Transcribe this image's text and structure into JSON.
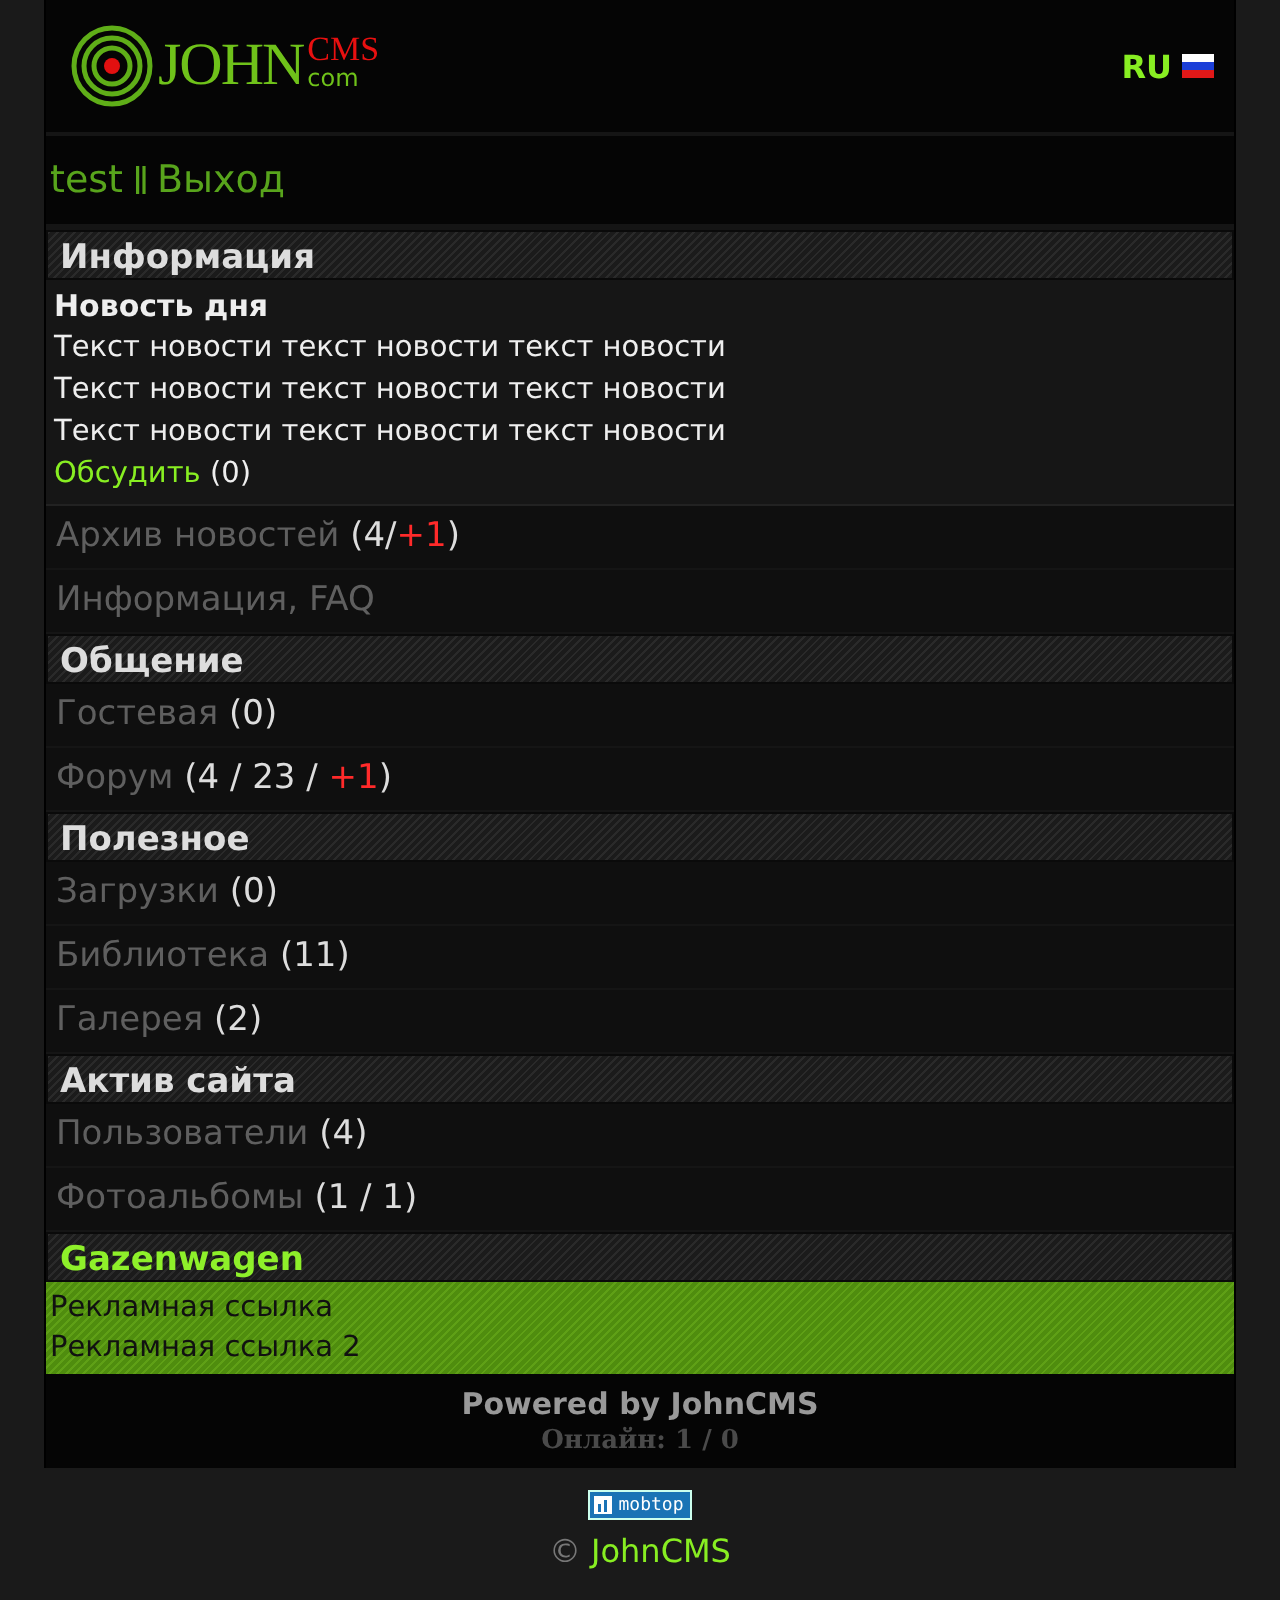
{
  "header": {
    "logo": {
      "name": "JOHN",
      "mark": "CMS",
      "domain": "com"
    },
    "language": "RU"
  },
  "user_bar": {
    "user": "test",
    "logout": "Выход"
  },
  "sections": [
    {
      "title": "Информация",
      "kind": "normal",
      "items": [
        {
          "kind": "news",
          "title": "Новость дня",
          "lines": [
            "Текст новости текст новости текст новости",
            "Текст новости текст новости текст новости",
            "Текст новости текст новости текст новости"
          ],
          "link": "Обсудить",
          "count": "(0)"
        },
        {
          "kind": "link",
          "label": "Архив новостей",
          "counter": [
            {
              "text": "(4/",
              "new": false
            },
            {
              "text": "+1",
              "new": true
            },
            {
              "text": ")",
              "new": false
            }
          ]
        },
        {
          "kind": "link",
          "label": "Информация, FAQ"
        }
      ]
    },
    {
      "title": "Общение",
      "kind": "normal",
      "items": [
        {
          "kind": "link",
          "label": "Гостевая",
          "counter": [
            {
              "text": "(0)",
              "new": false
            }
          ]
        },
        {
          "kind": "link",
          "label": "Форум",
          "counter": [
            {
              "text": "(4 / 23 / ",
              "new": false
            },
            {
              "text": "+1",
              "new": true
            },
            {
              "text": ")",
              "new": false
            }
          ]
        }
      ]
    },
    {
      "title": "Полезное",
      "kind": "normal",
      "items": [
        {
          "kind": "link",
          "label": "Загрузки",
          "counter": [
            {
              "text": "(0)",
              "new": false
            }
          ]
        },
        {
          "kind": "link",
          "label": "Библиотека",
          "counter": [
            {
              "text": "(11)",
              "new": false
            }
          ]
        },
        {
          "kind": "link",
          "label": "Галерея",
          "counter": [
            {
              "text": "(2)",
              "new": false
            }
          ]
        }
      ]
    },
    {
      "title": "Актив сайта",
      "kind": "normal",
      "items": [
        {
          "kind": "link",
          "label": "Пользователи",
          "counter": [
            {
              "text": "(4)",
              "new": false
            }
          ]
        },
        {
          "kind": "link",
          "label": "Фотоальбомы",
          "counter": [
            {
              "text": "(1 / 1)",
              "new": false
            }
          ]
        }
      ]
    },
    {
      "title": "Gazenwagen",
      "kind": "ads",
      "items": [
        {
          "kind": "ads",
          "lines": [
            "Рекламная ссылка",
            "Рекламная ссылка 2"
          ]
        }
      ]
    }
  ],
  "footer": {
    "powered": "Powered by JohnCMS",
    "online": "Онлайн: 1 / 0"
  },
  "counter_badge": "mobtop",
  "copyright": {
    "sign": "©",
    "link": "JohnCMS"
  }
}
